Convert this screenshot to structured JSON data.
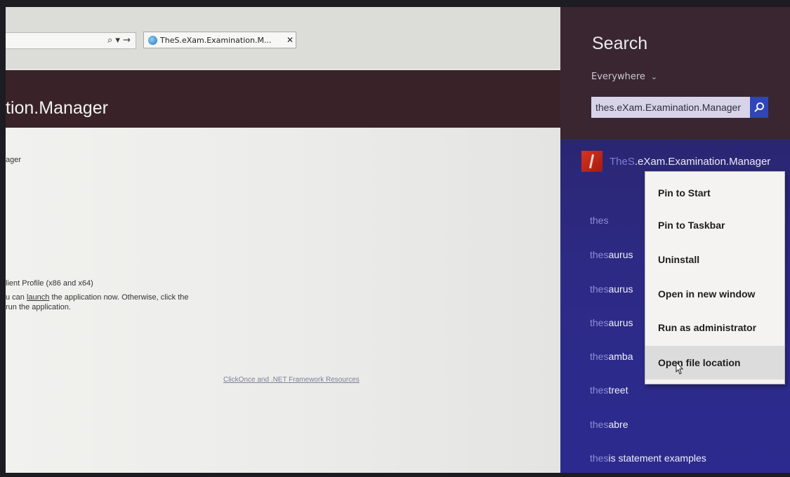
{
  "browser": {
    "tab": {
      "title": "TheS.eXam.Examination.M...",
      "close": "✕"
    },
    "address_controls": "⌕ ▾ →",
    "banner_title": "tion.Manager",
    "content_lines": {
      "name_fragment": "ager",
      "prerequisite": "lient Profile (x86 and x64)",
      "launch_prefix": "u can ",
      "launch_link": "launch",
      "launch_suffix": " the application now. Otherwise, click the",
      "run_line": "run the application."
    },
    "resources_link": "ClickOnce and .NET Framework Resources"
  },
  "search_panel": {
    "heading": "Search",
    "scope": "Everywhere",
    "scope_chevron": "⌄",
    "query": "thes.eXam.Examination.Manager",
    "result": {
      "name_highlight": "TheS",
      "name_rest": ".eXam.Examination.Manager"
    },
    "suggestions": [
      {
        "q": "thes",
        "rest": ""
      },
      {
        "q": "thes",
        "rest": "aurus"
      },
      {
        "q": "thes",
        "rest": "aurus"
      },
      {
        "q": "thes",
        "rest": "aurus"
      },
      {
        "q": "thes",
        "rest": "amba"
      },
      {
        "q": "thes",
        "rest": "treet"
      },
      {
        "q": "thes",
        "rest": "abre"
      },
      {
        "q": "thes",
        "rest": "is statement examples"
      }
    ]
  },
  "context_menu": {
    "items": [
      "Pin to Start",
      "Pin to Taskbar",
      "Uninstall",
      "Open in new window",
      "Run as administrator",
      "Open file location"
    ],
    "hovered_index": 5
  },
  "colors": {
    "banner": "#3a2229",
    "results_bg": "#2c2a8e",
    "search_button": "#2e46b7",
    "app_icon": "#c42a18"
  }
}
